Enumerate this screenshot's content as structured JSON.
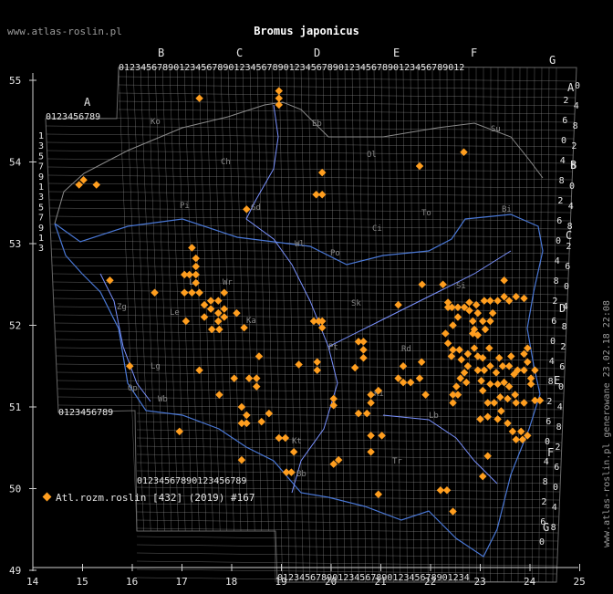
{
  "title": "Bromus japonicus",
  "site": "www.atlas-roslin.pl",
  "generated": "www.atlas-roslin.pl generowane 23.02.18 22:08",
  "legend": "Atl.rozm.roslin [432] (2019) #167",
  "colors": {
    "background": "#000000",
    "grid": "#8a8a8a",
    "border": "#4a78d6",
    "river": "#7a92ff",
    "point": "#ff9e1f",
    "text": "#e6e6e6"
  },
  "axes": {
    "x_ticks": [
      "14",
      "15",
      "16",
      "17",
      "18",
      "19",
      "20",
      "21",
      "22",
      "23",
      "24",
      "25"
    ],
    "y_ticks": [
      "55",
      "54",
      "53",
      "52",
      "51",
      "50",
      "49"
    ]
  },
  "grid_letters": {
    "columns": [
      "A",
      "B",
      "C",
      "D",
      "E",
      "F",
      "G"
    ],
    "rows": [
      "A",
      "B",
      "C",
      "D",
      "E",
      "F",
      "G"
    ]
  },
  "region_codes": [
    "Ko",
    "Eb",
    "Ol",
    "Su",
    "Ch",
    "Pi",
    "Gd",
    "To",
    "Ci",
    "Bi",
    "Wl",
    "Po",
    "Zg",
    "Le",
    "Lu",
    "Ka",
    "Sk",
    "Pt",
    "Rd",
    "Si",
    "Wr",
    "Lg",
    "Wb",
    "Op",
    "Kt",
    "Ki",
    "Tr",
    "Lb",
    "Bb"
  ],
  "points": [
    [
      17.35,
      54.78
    ],
    [
      18.95,
      54.87
    ],
    [
      18.95,
      54.78
    ],
    [
      18.95,
      54.7
    ],
    [
      22.67,
      54.12
    ],
    [
      21.78,
      53.95
    ],
    [
      19.82,
      53.87
    ],
    [
      15.02,
      53.78
    ],
    [
      14.93,
      53.72
    ],
    [
      15.28,
      53.72
    ],
    [
      19.7,
      53.6
    ],
    [
      19.82,
      53.6
    ],
    [
      18.3,
      53.42
    ],
    [
      17.2,
      52.95
    ],
    [
      17.28,
      52.82
    ],
    [
      17.28,
      52.72
    ],
    [
      17.28,
      52.62
    ],
    [
      17.15,
      52.62
    ],
    [
      17.05,
      52.62
    ],
    [
      15.55,
      52.55
    ],
    [
      17.28,
      52.52
    ],
    [
      21.83,
      52.5
    ],
    [
      16.45,
      52.4
    ],
    [
      17.05,
      52.4
    ],
    [
      17.2,
      52.4
    ],
    [
      17.35,
      52.4
    ],
    [
      17.58,
      52.3
    ],
    [
      17.73,
      52.3
    ],
    [
      17.58,
      52.2
    ],
    [
      17.85,
      52.4
    ],
    [
      17.73,
      52.15
    ],
    [
      17.73,
      52.05
    ],
    [
      17.45,
      52.1
    ],
    [
      17.45,
      52.25
    ],
    [
      21.35,
      52.25
    ],
    [
      17.85,
      52.1
    ],
    [
      17.85,
      52.2
    ],
    [
      18.1,
      52.15
    ],
    [
      17.6,
      51.95
    ],
    [
      17.75,
      51.95
    ],
    [
      17.08,
      52.05
    ],
    [
      18.25,
      51.97
    ],
    [
      19.65,
      52.05
    ],
    [
      19.75,
      52.05
    ],
    [
      19.82,
      52.05
    ],
    [
      19.82,
      51.97
    ],
    [
      15.95,
      51.5
    ],
    [
      17.35,
      51.45
    ],
    [
      18.55,
      51.62
    ],
    [
      18.05,
      51.35
    ],
    [
      18.35,
      51.35
    ],
    [
      18.5,
      51.35
    ],
    [
      18.5,
      51.25
    ],
    [
      17.75,
      51.15
    ],
    [
      18.2,
      51.0
    ],
    [
      18.3,
      50.9
    ],
    [
      18.2,
      50.8
    ],
    [
      18.6,
      50.82
    ],
    [
      18.75,
      50.92
    ],
    [
      18.3,
      50.8
    ],
    [
      16.95,
      50.7
    ],
    [
      18.95,
      50.62
    ],
    [
      19.08,
      50.62
    ],
    [
      19.25,
      50.45
    ],
    [
      18.2,
      50.35
    ],
    [
      19.1,
      50.2
    ],
    [
      19.2,
      50.2
    ],
    [
      20.05,
      50.3
    ],
    [
      20.15,
      50.35
    ],
    [
      20.55,
      51.8
    ],
    [
      20.65,
      51.8
    ],
    [
      20.65,
      51.7
    ],
    [
      20.65,
      51.6
    ],
    [
      19.35,
      51.52
    ],
    [
      19.72,
      51.55
    ],
    [
      20.48,
      51.48
    ],
    [
      19.72,
      51.45
    ],
    [
      20.05,
      51.1
    ],
    [
      20.05,
      51.02
    ],
    [
      20.55,
      50.92
    ],
    [
      20.72,
      50.92
    ],
    [
      20.8,
      51.05
    ],
    [
      20.8,
      51.15
    ],
    [
      20.95,
      51.2
    ],
    [
      21.45,
      51.5
    ],
    [
      21.35,
      51.35
    ],
    [
      21.45,
      51.3
    ],
    [
      21.78,
      51.35
    ],
    [
      21.82,
      51.55
    ],
    [
      21.6,
      51.3
    ],
    [
      21.9,
      51.15
    ],
    [
      20.8,
      50.65
    ],
    [
      20.8,
      50.45
    ],
    [
      21.02,
      50.65
    ],
    [
      20.95,
      49.93
    ],
    [
      22.2,
      49.98
    ],
    [
      22.33,
      49.98
    ],
    [
      22.45,
      49.72
    ],
    [
      23.05,
      50.15
    ],
    [
      23.15,
      50.4
    ],
    [
      22.35,
      52.22
    ],
    [
      22.43,
      52.22
    ],
    [
      22.55,
      52.22
    ],
    [
      22.68,
      52.22
    ],
    [
      22.78,
      52.28
    ],
    [
      22.92,
      52.25
    ],
    [
      23.08,
      52.3
    ],
    [
      23.2,
      52.3
    ],
    [
      23.35,
      52.3
    ],
    [
      23.48,
      52.35
    ],
    [
      23.58,
      52.3
    ],
    [
      23.72,
      52.35
    ],
    [
      23.88,
      52.33
    ],
    [
      23.48,
      52.55
    ],
    [
      22.25,
      52.5
    ],
    [
      22.55,
      52.1
    ],
    [
      22.45,
      52.0
    ],
    [
      22.3,
      51.9
    ],
    [
      22.35,
      51.78
    ],
    [
      22.45,
      51.7
    ],
    [
      22.42,
      51.62
    ],
    [
      22.58,
      51.7
    ],
    [
      22.75,
      51.65
    ],
    [
      22.88,
      51.72
    ],
    [
      22.95,
      51.62
    ],
    [
      23.05,
      51.6
    ],
    [
      22.75,
      51.5
    ],
    [
      22.68,
      51.42
    ],
    [
      22.6,
      51.35
    ],
    [
      22.52,
      51.25
    ],
    [
      22.45,
      51.15
    ],
    [
      22.55,
      51.15
    ],
    [
      22.72,
      51.3
    ],
    [
      22.95,
      51.45
    ],
    [
      23.08,
      51.45
    ],
    [
      23.2,
      51.5
    ],
    [
      23.38,
      51.6
    ],
    [
      23.45,
      51.5
    ],
    [
      23.58,
      51.5
    ],
    [
      23.68,
      51.4
    ],
    [
      23.75,
      51.45
    ],
    [
      23.88,
      51.45
    ],
    [
      23.95,
      51.55
    ],
    [
      23.88,
      51.65
    ],
    [
      23.95,
      51.72
    ],
    [
      24.1,
      51.45
    ],
    [
      23.2,
      51.28
    ],
    [
      23.35,
      51.28
    ],
    [
      23.48,
      51.3
    ],
    [
      23.58,
      51.25
    ],
    [
      23.7,
      51.15
    ],
    [
      23.55,
      51.1
    ],
    [
      23.4,
      51.12
    ],
    [
      23.28,
      51.05
    ],
    [
      23.15,
      51.05
    ],
    [
      23.05,
      51.2
    ],
    [
      23.88,
      51.05
    ],
    [
      23.72,
      51.05
    ],
    [
      24.1,
      51.08
    ],
    [
      24.2,
      51.08
    ],
    [
      22.45,
      51.05
    ],
    [
      23.0,
      50.85
    ],
    [
      23.15,
      50.88
    ],
    [
      23.35,
      50.85
    ],
    [
      23.55,
      50.8
    ],
    [
      23.65,
      50.7
    ],
    [
      23.72,
      50.6
    ],
    [
      23.85,
      50.6
    ],
    [
      23.95,
      50.65
    ],
    [
      23.82,
      50.7
    ],
    [
      23.42,
      50.95
    ],
    [
      22.85,
      51.9
    ],
    [
      22.95,
      51.88
    ],
    [
      23.1,
      51.95
    ],
    [
      22.85,
      52.05
    ],
    [
      23.05,
      52.05
    ],
    [
      23.2,
      52.05
    ],
    [
      22.95,
      52.15
    ],
    [
      22.78,
      52.18
    ],
    [
      22.62,
      51.58
    ],
    [
      23.02,
      51.32
    ],
    [
      23.32,
      51.42
    ],
    [
      23.62,
      51.62
    ],
    [
      24.02,
      51.28
    ],
    [
      24.02,
      51.35
    ],
    [
      22.35,
      52.28
    ],
    [
      23.25,
      52.15
    ],
    [
      22.88,
      51.95
    ],
    [
      23.18,
      51.72
    ]
  ]
}
